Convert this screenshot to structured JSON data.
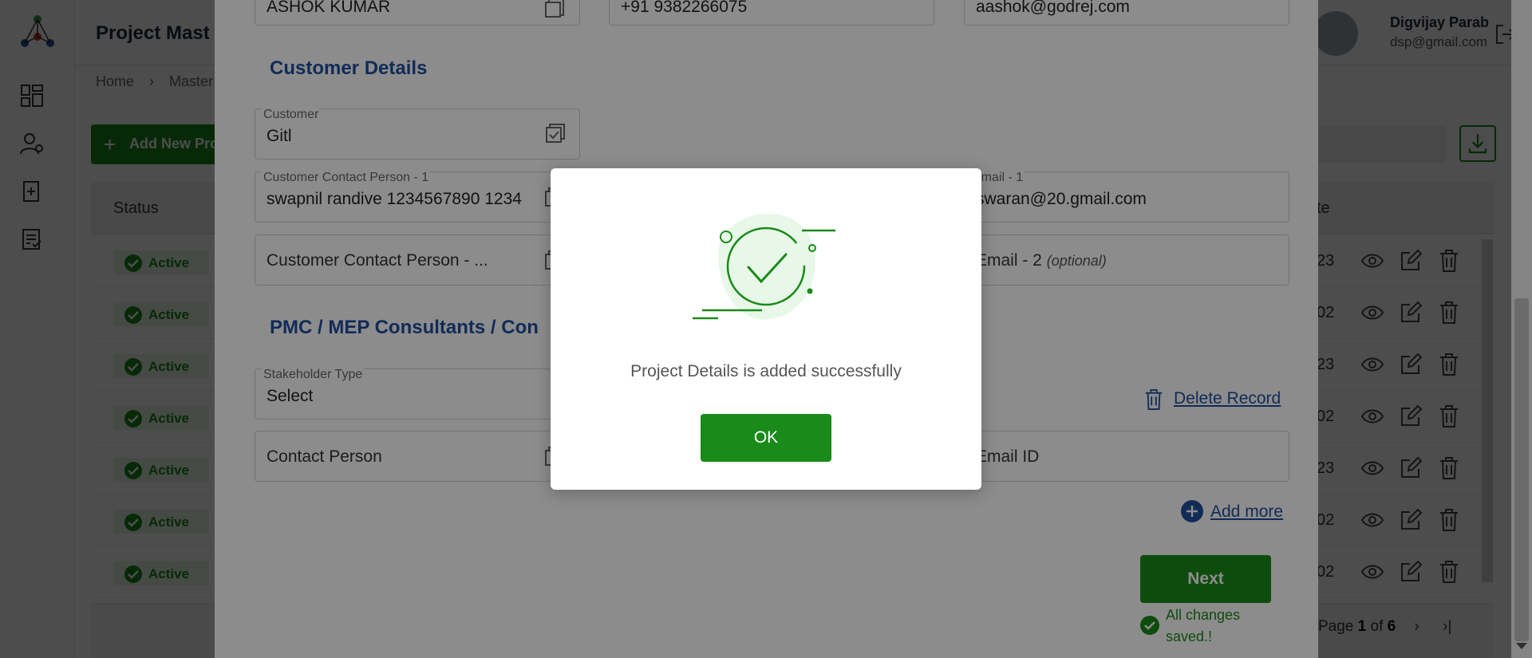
{
  "app": {
    "title": "Project Mast",
    "user_name": "Digvijay Parab",
    "user_email": "dsp@gmail.com",
    "breadcrumb": [
      "Home",
      "Master"
    ],
    "add_button": "Add New Pro",
    "table_header_status": "Status",
    "table_header_date": "te",
    "status_label": "Active",
    "date_fragments": [
      "23",
      "02",
      "23",
      "02",
      "23",
      "02",
      "02"
    ],
    "pagination": {
      "prefix": "Page",
      "current": "1",
      "of": "of",
      "total": "6"
    }
  },
  "form": {
    "top_fields": [
      "ASHOK KUMAR",
      "+91 9382266075",
      "aashok@godrej.com"
    ],
    "customer_section_title": "Customer Details",
    "customer": {
      "label": "Customer",
      "value": "Gitl"
    },
    "contact_person_1": {
      "label": "Customer Contact Person - 1",
      "value": "swapnil randive 1234567890 1234"
    },
    "email_1": {
      "label": "Email - 1",
      "value": "swaran@20.gmail.com"
    },
    "contact_person_2_placeholder": "Customer Contact Person - ...",
    "email_2_placeholder": "Email - 2",
    "email_2_optional": "(optional)",
    "pmc_section_title": "PMC / MEP Consultants / Con",
    "stakeholder": {
      "label": "Stakeholder Type",
      "value": "Select"
    },
    "delete_record": "Delete Record",
    "contact_person_placeholder": "Contact Person",
    "email_id_placeholder": "Email ID",
    "add_more": "Add more",
    "next_button": "Next",
    "save_status": "All changes saved.!"
  },
  "dialog": {
    "message": "Project Details is added successfully",
    "ok_button": "OK"
  },
  "colors": {
    "primary_green": "#1a8a1a",
    "section_blue": "#1f4f9e",
    "success_light": "#e8f8e8"
  }
}
